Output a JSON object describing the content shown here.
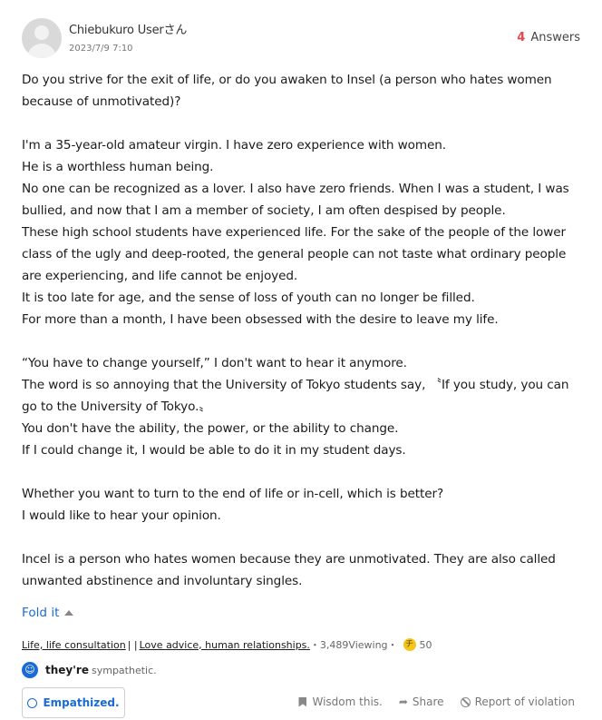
{
  "header": {
    "user_name": "Chiebukuro Userさん",
    "date": "2023/7/9 7:10",
    "answers_count": "4",
    "answers_label": "Answers"
  },
  "question": {
    "paragraphs": [
      [
        "Do you strive for the exit of life, or do you awaken to Insel (a person who hates women because of unmotivated)?"
      ],
      [
        "I'm a 35-year-old amateur virgin. I have zero experience with women.",
        "He is a worthless human being.",
        "No one can be recognized as a lover. I also have zero friends. When I was a student, I was bullied, and now that I am a member of society, I am often despised by people.",
        "These high school students have experienced life. For the sake of the people of the lower class of the ugly and deep-rooted, the general people can not taste what ordinary people are experiencing, and life cannot be enjoyed.",
        "It is too late for age, and the sense of loss of youth can no longer be filled.",
        "For more than a month, I have been obsessed with the desire to leave my life."
      ],
      [
        "“You have to change yourself,” I don't want to hear it anymore.",
        "The word is so annoying that the University of Tokyo students say, 〝If you study, you can go to the University of Tokyo.〟",
        "You don't have the ability, the power, or the ability to change.",
        "If I could change it, I would be able to do it in my student days."
      ],
      [
        "Whether you want to turn to the end of life or in-cell, which is better?",
        "I would like to hear your opinion."
      ],
      [
        "Incel is a person who hates women because they are unmotivated. They are also called unwanted abstinence and involuntary singles."
      ]
    ]
  },
  "fold_label": "Fold it",
  "meta": {
    "category_1": "Life, life consultation",
    "separator": "| |",
    "category_2": "Love advice, human relationships.",
    "views": "・3,489Viewing・",
    "coin_symbol": "チ",
    "coins": "50"
  },
  "sympathy": {
    "who": "they're",
    "text": "sympathetic."
  },
  "buttons": {
    "empathized": "Empathized.",
    "wisdom": "Wisdom this.",
    "share": "Share",
    "report": "Report of violation"
  },
  "icons": {
    "avatar": "default-user-avatar",
    "empathy": "smile-icon",
    "wisdom": "bookmark-icon",
    "share": "share-arrow-icon",
    "report": "prohibited-icon"
  },
  "colors": {
    "accent_blue": "#1a6bd6",
    "answers_red": "#e8454f",
    "coin_yellow": "#f5c518"
  }
}
